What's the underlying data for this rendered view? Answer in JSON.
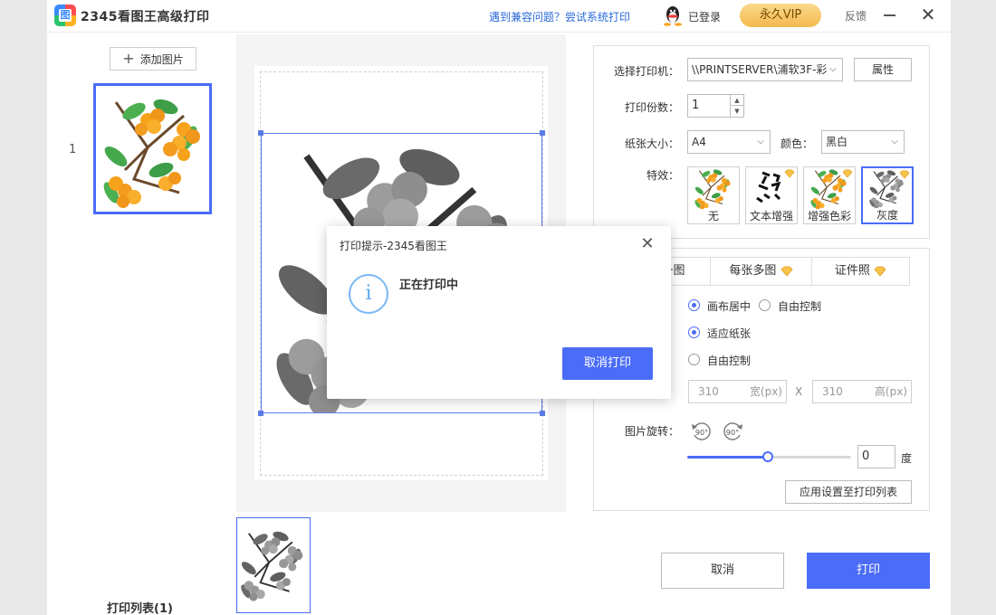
{
  "titlebar": {
    "app_title": "2345看图王高级打印",
    "logo_glyph": "图",
    "compat_link": "遇到兼容问题？尝试系统打印",
    "login_status": "已登录",
    "vip_label": "永久VIP",
    "feedback": "反馈",
    "close_glyph": "✕"
  },
  "left": {
    "add_image": "添加图片",
    "add_glyph": "+",
    "thumb_index": "1",
    "print_list": "打印列表(1)"
  },
  "settings": {
    "printer_label": "选择打印机：",
    "printer_value": "\\\\PRINTSERVER\\浦软3F-彩",
    "properties": "属性",
    "copies_label": "打印份数：",
    "copies_value": "1",
    "paper_label": "纸张大小：",
    "paper_value": "A4",
    "color_label": "颜色：",
    "color_value": "黑白",
    "effects_label": "特效：",
    "effects": [
      {
        "label": "无",
        "premium": false,
        "selected": false
      },
      {
        "label": "文本增强",
        "premium": true,
        "selected": false
      },
      {
        "label": "增强色彩",
        "premium": true,
        "selected": false
      },
      {
        "label": "灰度",
        "premium": true,
        "selected": true
      }
    ]
  },
  "layout": {
    "tabs": [
      "每张一图",
      "每张多图",
      "证件照"
    ],
    "tab_visible_first": "图",
    "position_options": [
      "画布居中",
      "自由控制"
    ],
    "size_options": [
      "适应纸张",
      "自由控制"
    ],
    "width_value": "310",
    "width_unit": "宽(px)",
    "times": "X",
    "height_value": "310",
    "height_unit": "高(px)",
    "rotate_label": "图片旋转：",
    "rotate_ccw": "90°",
    "rotate_cw": "90°",
    "rotation_value": "0",
    "rotation_fraction": 0.49,
    "degree_unit": "度",
    "apply_button": "应用设置至打印列表"
  },
  "actions": {
    "cancel": "取消",
    "print": "打印"
  },
  "dialog": {
    "title": "打印提示-2345看图王",
    "close_glyph": "✕",
    "info_glyph": "i",
    "message": "正在打印中",
    "cancel_print": "取消打印"
  },
  "colors": {
    "accent": "#4a6cf7",
    "vip_gold": "#f3b94d",
    "link": "#2b6ad8"
  }
}
